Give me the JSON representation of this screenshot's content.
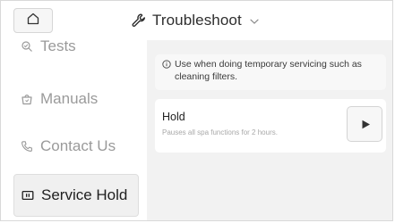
{
  "header": {
    "title": "Troubleshoot",
    "home_icon": "home-icon",
    "title_icon": "wrench-icon",
    "dropdown_icon": "chevron-down-icon"
  },
  "sidebar": {
    "items": [
      {
        "label": "Tests",
        "icon": "tests-icon",
        "active": false
      },
      {
        "label": "Manuals",
        "icon": "manuals-icon",
        "active": false
      },
      {
        "label": "Contact Us",
        "icon": "phone-icon",
        "active": false
      },
      {
        "label": "Service Hold",
        "icon": "pause-icon",
        "active": true
      }
    ]
  },
  "main": {
    "info": {
      "icon": "info-icon",
      "text": "Use when doing temporary servicing such as cleaning filters."
    },
    "hold_card": {
      "title": "Hold",
      "description": "Pauses all spa functions for 2 hours.",
      "action_icon": "play-icon"
    }
  },
  "colors": {
    "panel_background": "#f2f2f2",
    "active_item_background": "#f0f0f0",
    "inactive_text": "#9a9a9a"
  }
}
